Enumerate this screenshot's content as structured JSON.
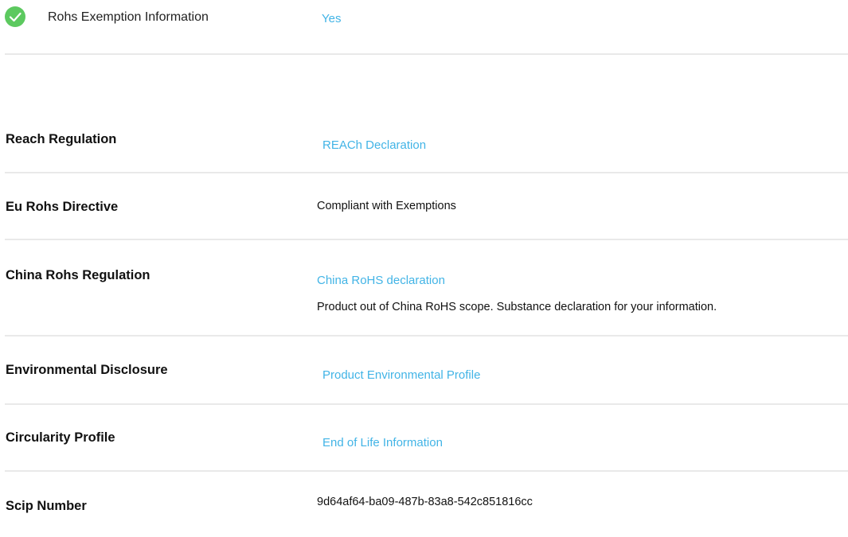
{
  "rohs_exemption": {
    "label": "Rohs Exemption Information",
    "value": "Yes"
  },
  "rows": [
    {
      "label": "Reach Regulation",
      "link": "REACh Declaration"
    },
    {
      "label": "Eu Rohs Directive",
      "value": "Compliant with Exemptions"
    },
    {
      "label": "China Rohs Regulation",
      "link": "China RoHS declaration",
      "note": "Product out of China RoHS scope. Substance declaration for your information."
    },
    {
      "label": "Environmental Disclosure",
      "link": "Product Environmental Profile"
    },
    {
      "label": "Circularity Profile",
      "link": "End of Life Information"
    },
    {
      "label": "Scip Number",
      "value": "9d64af64-ba09-487b-83a8-542c851816cc"
    }
  ],
  "colors": {
    "link": "#42b4e6",
    "check_badge": "#5cc95f",
    "divider": "#e9e9e9"
  },
  "icons": {
    "status": "check-circle-icon"
  }
}
